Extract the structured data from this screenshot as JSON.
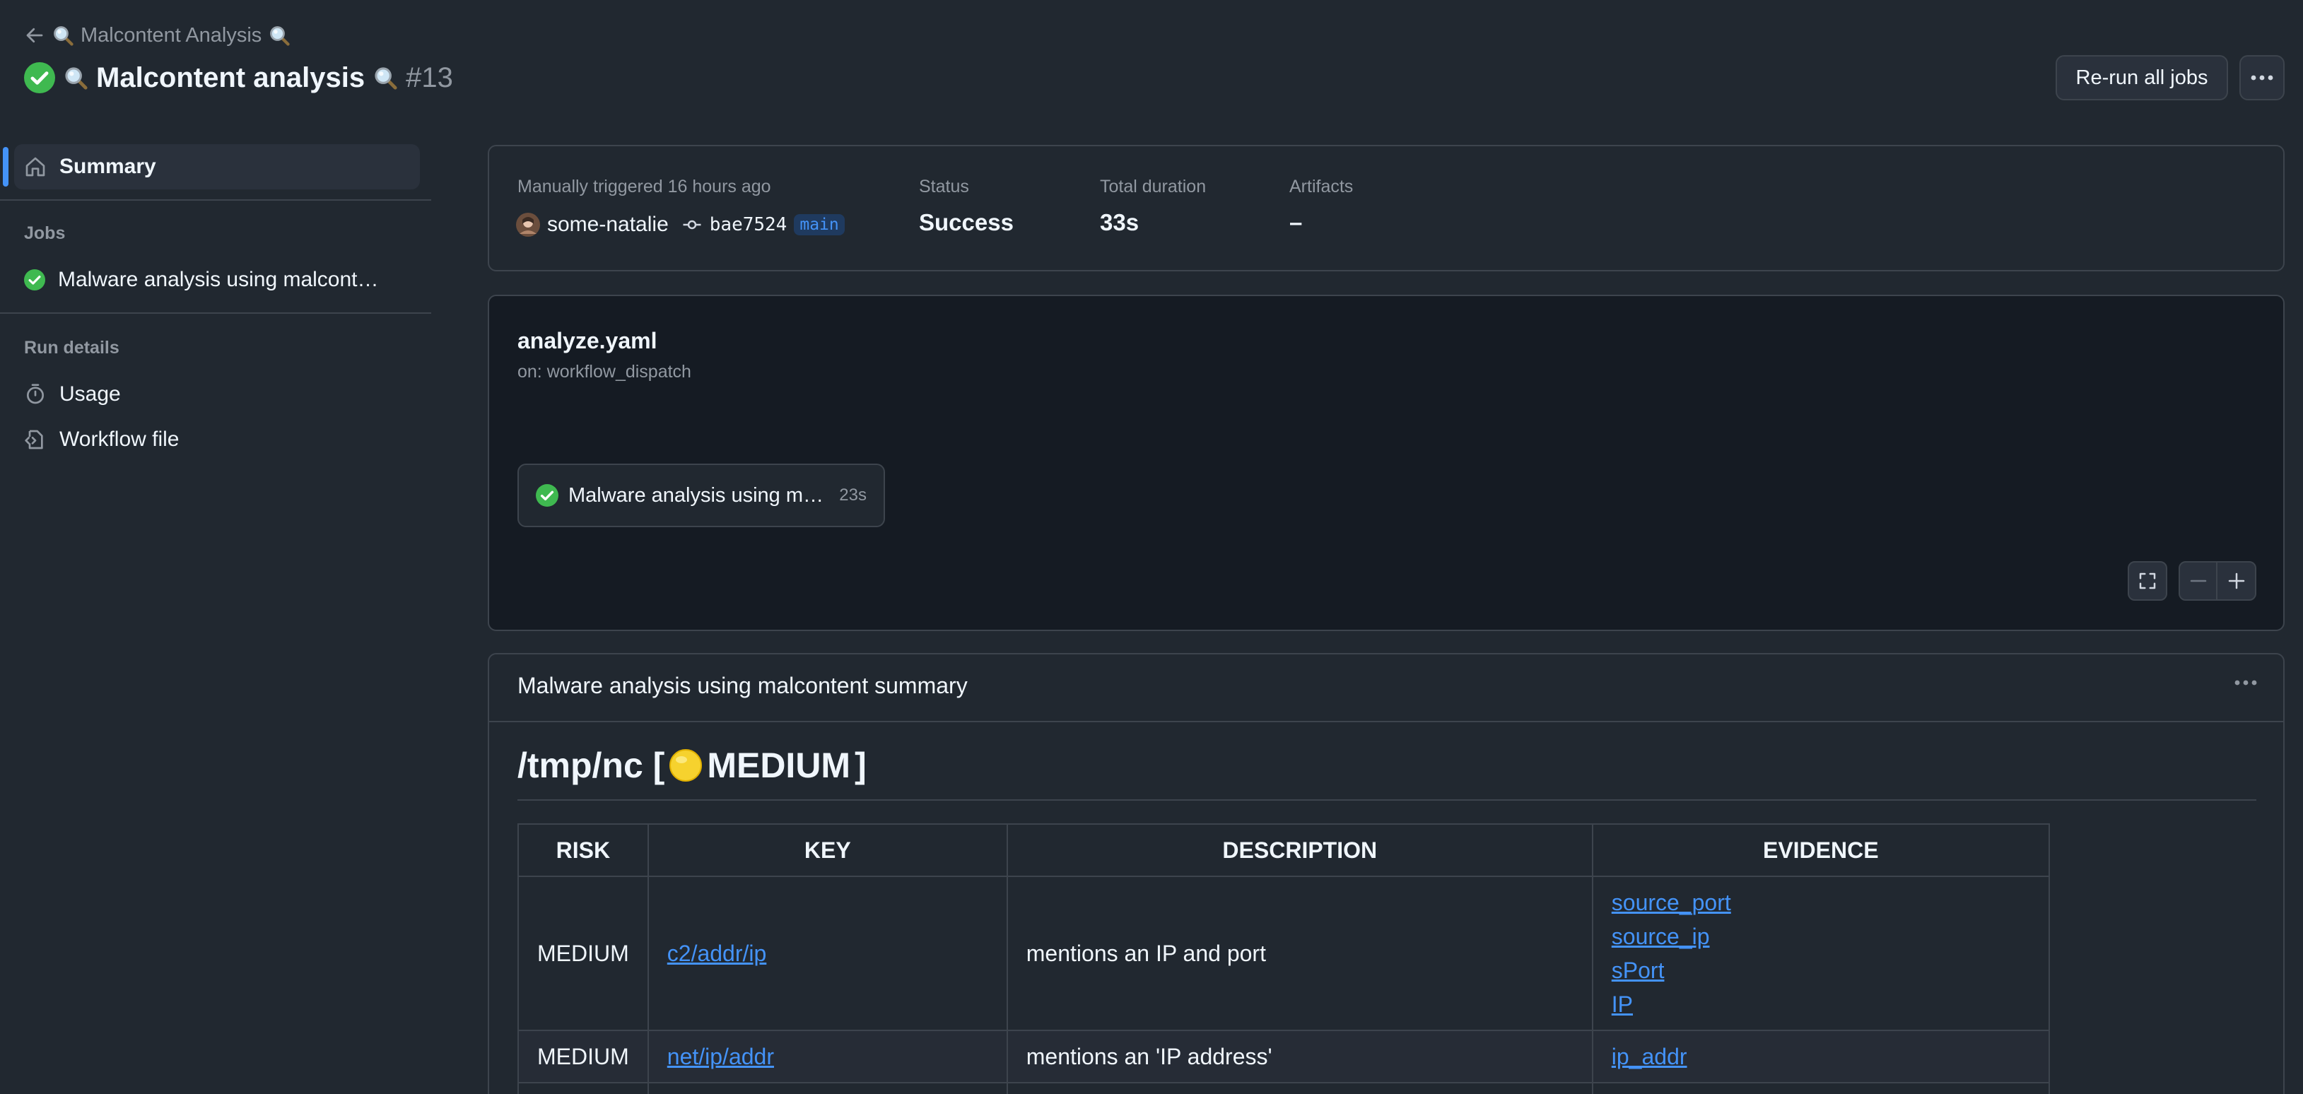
{
  "header": {
    "back_label": "Malcontent Analysis",
    "title": "Malcontent analysis",
    "run_number": "#13",
    "rerun_label": "Re-run all jobs"
  },
  "sidebar": {
    "summary_label": "Summary",
    "jobs_heading": "Jobs",
    "job_item_label": "Malware analysis using malcont…",
    "run_details_heading": "Run details",
    "usage_label": "Usage",
    "workflow_file_label": "Workflow file"
  },
  "run_info": {
    "trigger_label": "Manually triggered 16 hours ago",
    "actor": "some-natalie",
    "commit": "bae7524",
    "branch": "main",
    "status_label": "Status",
    "status_value": "Success",
    "duration_label": "Total duration",
    "duration_value": "33s",
    "artifacts_label": "Artifacts",
    "artifacts_value": "–"
  },
  "workflow": {
    "file_name": "analyze.yaml",
    "trigger": "on: workflow_dispatch",
    "job_name": "Malware analysis using malcontent",
    "job_duration": "23s"
  },
  "summary": {
    "title": "Malware analysis using malcontent summary",
    "heading_prefix": "/tmp/nc [",
    "heading_level": "MEDIUM",
    "heading_suffix": "]",
    "columns": [
      "RISK",
      "KEY",
      "DESCRIPTION",
      "EVIDENCE"
    ],
    "rows": [
      {
        "risk": "MEDIUM",
        "key": "c2/addr/ip",
        "description": "mentions an IP and port",
        "evidence": [
          "source_port",
          "source_ip",
          "sPort",
          "IP"
        ]
      },
      {
        "risk": "MEDIUM",
        "key": "net/ip/addr",
        "description": "mentions an 'IP address'",
        "evidence": [
          "ip_addr"
        ]
      }
    ]
  },
  "colors": {
    "background": "#212830",
    "success": "#3fb950",
    "link": "#4493f8",
    "medium_badge": "#f6d22e"
  }
}
